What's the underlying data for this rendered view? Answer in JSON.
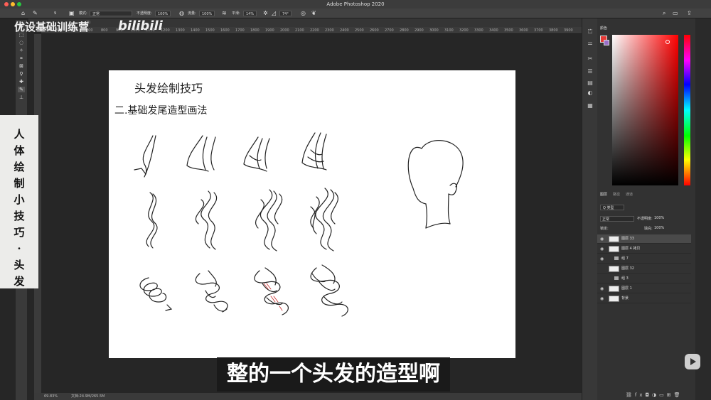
{
  "window": {
    "title": "Adobe Photoshop 2020"
  },
  "options_bar": {
    "mode_label": "模式:",
    "mode_value": "正常",
    "opacity_label": "不透明度:",
    "opacity_value": "100%",
    "flow_label": "流量:",
    "flow_value": "100%",
    "smooth_label": "平滑:",
    "smooth_value": "14%",
    "angle_value": "74°",
    "brush_size": "9"
  },
  "tab": {
    "label": "(8)"
  },
  "ruler": {
    "ticks": [
      "400",
      "500",
      "600",
      "700",
      "800",
      "900",
      "1000",
      "1100",
      "1200",
      "1300",
      "1400",
      "1500",
      "1600",
      "1700",
      "1800",
      "1900",
      "2000",
      "2100",
      "2200",
      "2300",
      "2400",
      "2500",
      "2600",
      "2700",
      "2800",
      "2900",
      "3000",
      "3100",
      "3200",
      "3300",
      "3400",
      "3500",
      "3600",
      "3700",
      "3800",
      "3900"
    ]
  },
  "status": {
    "zoom": "69.83%",
    "doc": "文档:24.9M/265.5M"
  },
  "color_panel": {
    "tab": "颜色",
    "foreground": "#e53935",
    "background": "#9a6fc9"
  },
  "layers_panel": {
    "tabs": [
      "图层",
      "路径",
      "通道"
    ],
    "filter_value": "Q 类型",
    "blend_mode": "正常",
    "opacity_label": "不透明度:",
    "opacity_value": "100%",
    "lock_label": "锁定:",
    "fill_label": "填充:",
    "fill_value": "100%",
    "layers": [
      {
        "name": "图层 33",
        "visible": true,
        "type": "layer",
        "selected": true
      },
      {
        "name": "图层 4 拷贝",
        "visible": true,
        "type": "layer",
        "selected": false
      },
      {
        "name": "组 7",
        "visible": true,
        "type": "group",
        "selected": false
      },
      {
        "name": "图层 32",
        "visible": false,
        "type": "layer",
        "selected": false
      },
      {
        "name": "组 3",
        "visible": false,
        "type": "group",
        "selected": false
      },
      {
        "name": "图层 1",
        "visible": true,
        "type": "layer",
        "selected": false
      },
      {
        "name": "背景",
        "visible": true,
        "type": "layer",
        "selected": false
      }
    ]
  },
  "canvas": {
    "heading": "头发绘制技巧",
    "subheading": "二.基础发尾造型画法"
  },
  "overlay": {
    "watermark": "优设基础训练营",
    "logo": "bilibili",
    "side_banner": [
      "人",
      "体",
      "绘",
      "制",
      "小",
      "技",
      "巧",
      "·",
      "头",
      "发"
    ],
    "subtitle": "整的一个头发的造型啊"
  }
}
